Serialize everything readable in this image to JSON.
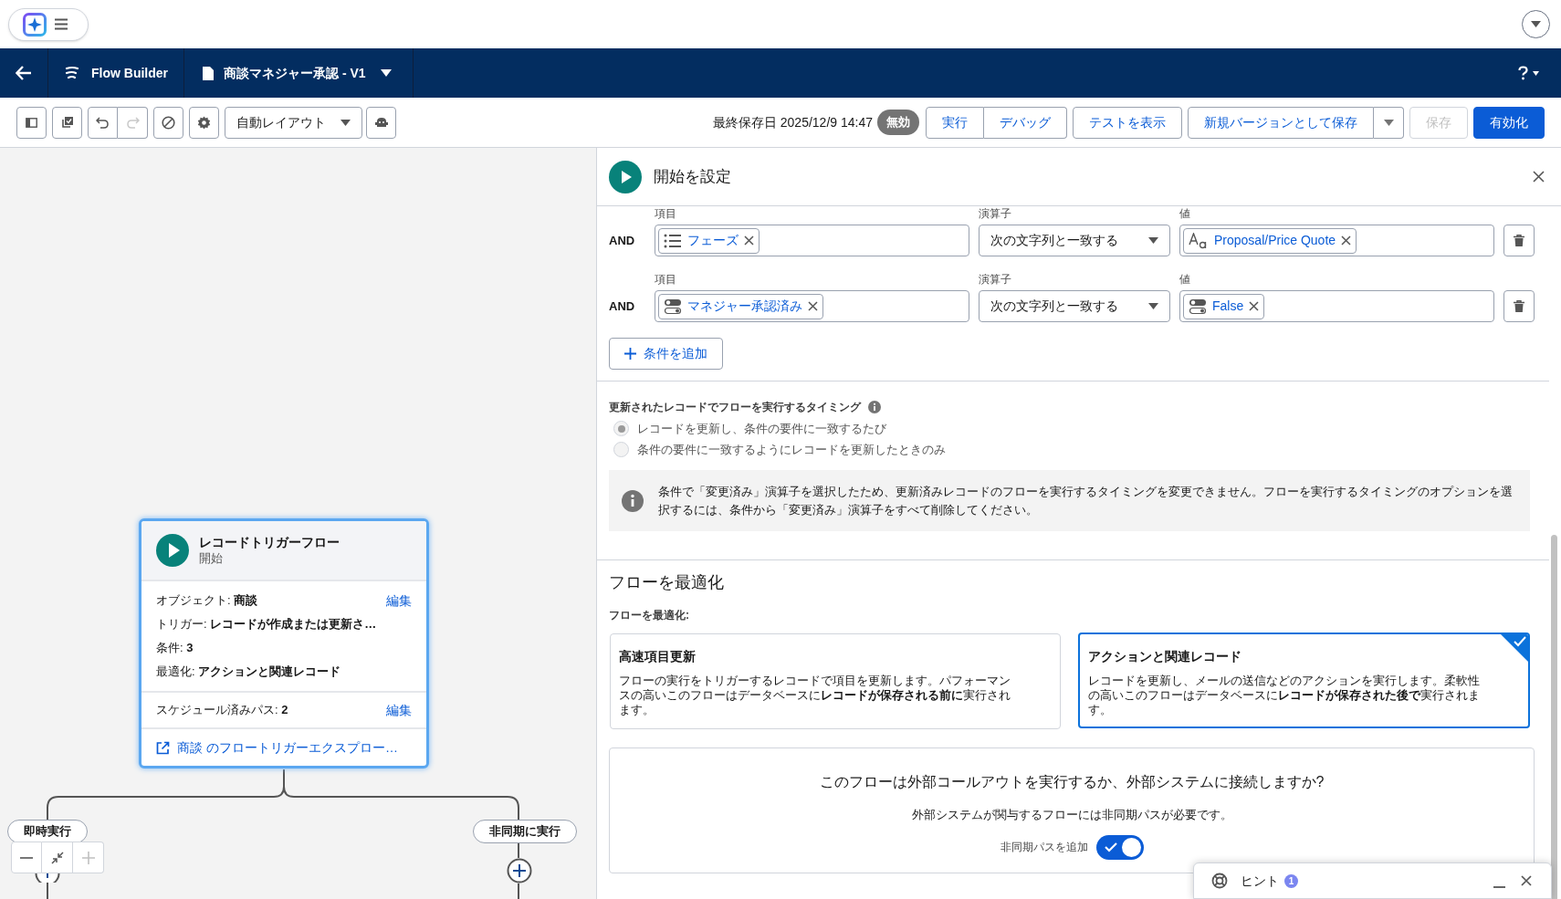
{
  "header": {
    "app_name": "Flow Builder",
    "flow_name": "商談マネジャー承認 - V1"
  },
  "toolbar": {
    "redo": {
      "disabled": true
    },
    "layout": "自動レイアウト",
    "last_saved": "最終保存日 2025/12/9 14:47",
    "status": "無効",
    "button_groups": [
      {
        "buttons": [
          {
            "kind": "text",
            "label": "実行",
            "disabled": false
          },
          {
            "kind": "text",
            "label": "デバッグ",
            "disabled": false
          }
        ]
      },
      {
        "buttons": [
          {
            "kind": "text",
            "label": "テストを表示",
            "disabled": false
          }
        ]
      },
      {
        "buttons": [
          {
            "kind": "text",
            "label": "新規バージョンとして保存",
            "disabled": false
          },
          {
            "kind": "menu",
            "disabled": false
          }
        ]
      },
      {
        "buttons": [
          {
            "kind": "text",
            "label": "保存",
            "disabled": true
          }
        ]
      },
      {
        "buttons": [
          {
            "kind": "primary",
            "label": "有効化",
            "disabled": false
          }
        ]
      }
    ]
  },
  "canvas": {
    "start_node": {
      "selected": true,
      "title": "レコードトリガーフロー",
      "subtitle": "開始",
      "details": [
        {
          "label": "オブジェクト:",
          "value": "商談",
          "edit": "編集"
        },
        {
          "label": "トリガー:",
          "value": "レコードが作成または更新さ…"
        },
        {
          "label": "条件:",
          "value": "3"
        },
        {
          "label": "最適化:",
          "value": "アクションと関連レコード"
        }
      ],
      "scheduled": {
        "label": "スケジュール済みパス:",
        "value": "2",
        "edit": "編集"
      },
      "explorer_link": "商談 のフロートリガーエクスプロー…"
    },
    "branches": [
      {
        "label": "即時実行"
      },
      {
        "label": "非同期に実行"
      }
    ]
  },
  "panel": {
    "title": "開始を設定",
    "conditions": [
      {
        "logic": "AND",
        "field_label": "項目",
        "field": {
          "kind": "picklist",
          "text": "フェーズ"
        },
        "operator_label": "演算子",
        "operator": "次の文字列と一致する",
        "value_label": "値",
        "value": {
          "kind": "text",
          "text": "Proposal/Price Quote"
        }
      },
      {
        "logic": "AND",
        "field_label": "項目",
        "field": {
          "kind": "boolean",
          "text": "マネジャー承認済み"
        },
        "operator_label": "演算子",
        "operator": "次の文字列と一致する",
        "value_label": "値",
        "value": {
          "kind": "boolean",
          "text": "False"
        }
      }
    ],
    "add_condition": "条件を追加",
    "timing": {
      "title": "更新されたレコードでフローを実行するタイミング",
      "options": [
        {
          "label": "レコードを更新し、条件の要件に一致するたび",
          "selected": true,
          "disabled": true
        },
        {
          "label": "条件の要件に一致するようにレコードを更新したときのみ",
          "selected": false,
          "disabled": true
        }
      ],
      "info": "条件で「変更済み」演算子を選択したため、更新済みレコードのフローを実行するタイミングを変更できません。フローを実行するタイミングのオプションを選択するには、条件から「変更済み」演算子をすべて削除してください。"
    },
    "optimize": {
      "heading": "フローを最適化",
      "label": "フローを最適化:",
      "options": [
        {
          "title": "高速項目更新",
          "description": "フローの実行をトリガーするレコードで項目を更新します。パフォーマンスの高いこのフローはデータベースに**レコードが保存される前に**実行されます。",
          "selected": false
        },
        {
          "title": "アクションと関連レコード",
          "description": "レコードを更新し、メールの送信などのアクションを実行します。柔軟性の高いこのフローはデータベースに**レコードが保存された後で**実行されます。",
          "selected": true
        }
      ]
    },
    "callout": {
      "question": "このフローは外部コールアウトを実行するか、外部システムに接続しますか?",
      "note": "外部システムが関与するフローには非同期パスが必要です。",
      "toggle_label": "非同期パスを追加",
      "toggle_on": true
    }
  },
  "hint": {
    "label": "ヒント",
    "count": "1"
  }
}
